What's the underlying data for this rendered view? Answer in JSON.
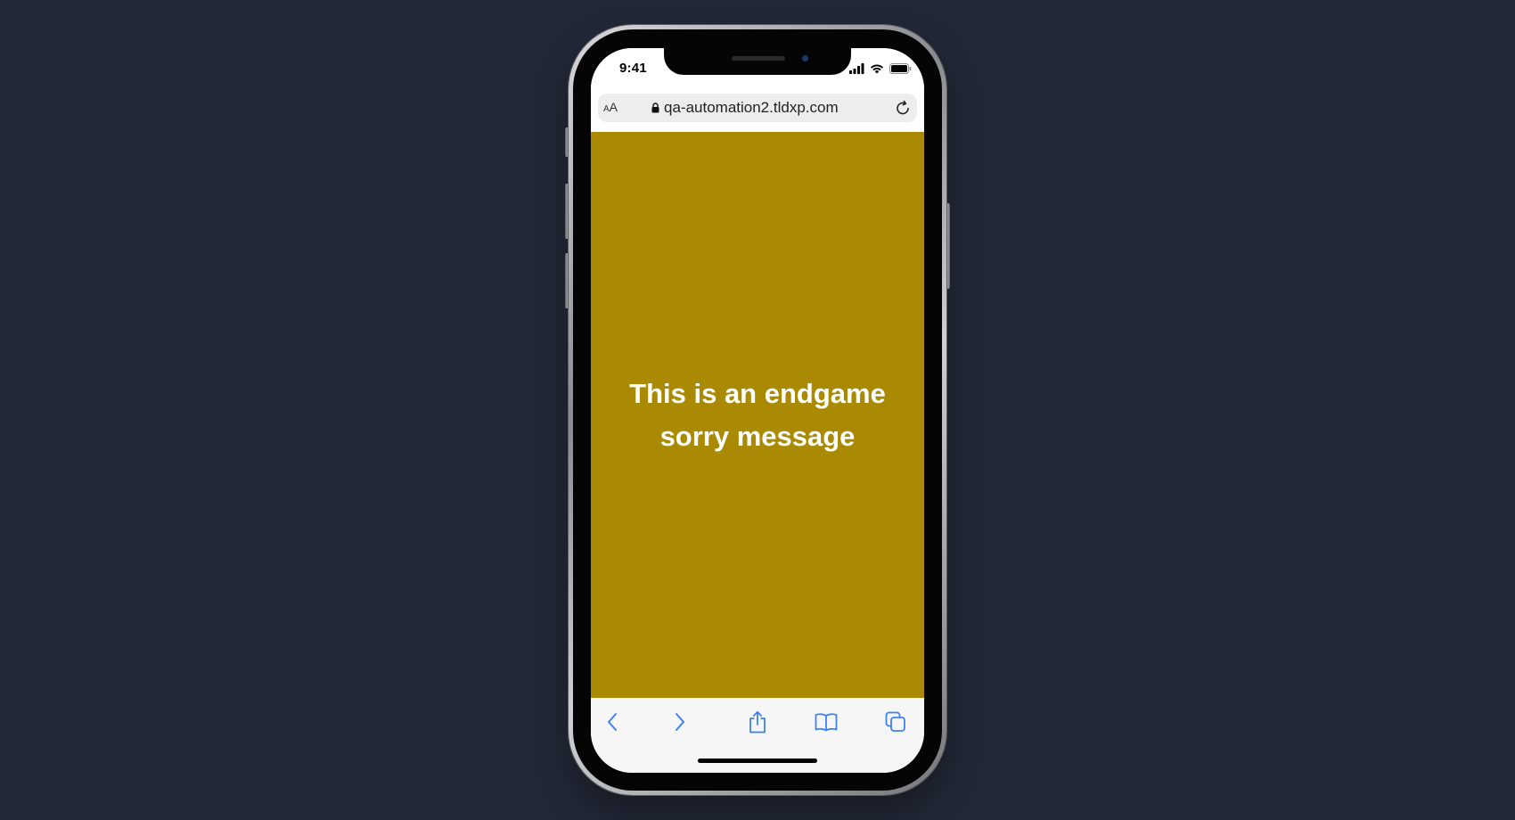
{
  "status_bar": {
    "time": "9:41"
  },
  "address_bar": {
    "text_size_large": "A",
    "text_size_small": "A",
    "url": "qa-automation2.tldxp.com"
  },
  "page": {
    "message": "This is an endgame sorry message",
    "background_color": "#aa8a02"
  },
  "toolbar": {
    "icons": [
      "back-icon",
      "forward-icon",
      "share-icon",
      "bookmarks-icon",
      "tabs-icon"
    ],
    "accent_color": "#3b82f6"
  },
  "colors": {
    "backdrop": "#222836",
    "text_on_content": "#ffffff"
  }
}
